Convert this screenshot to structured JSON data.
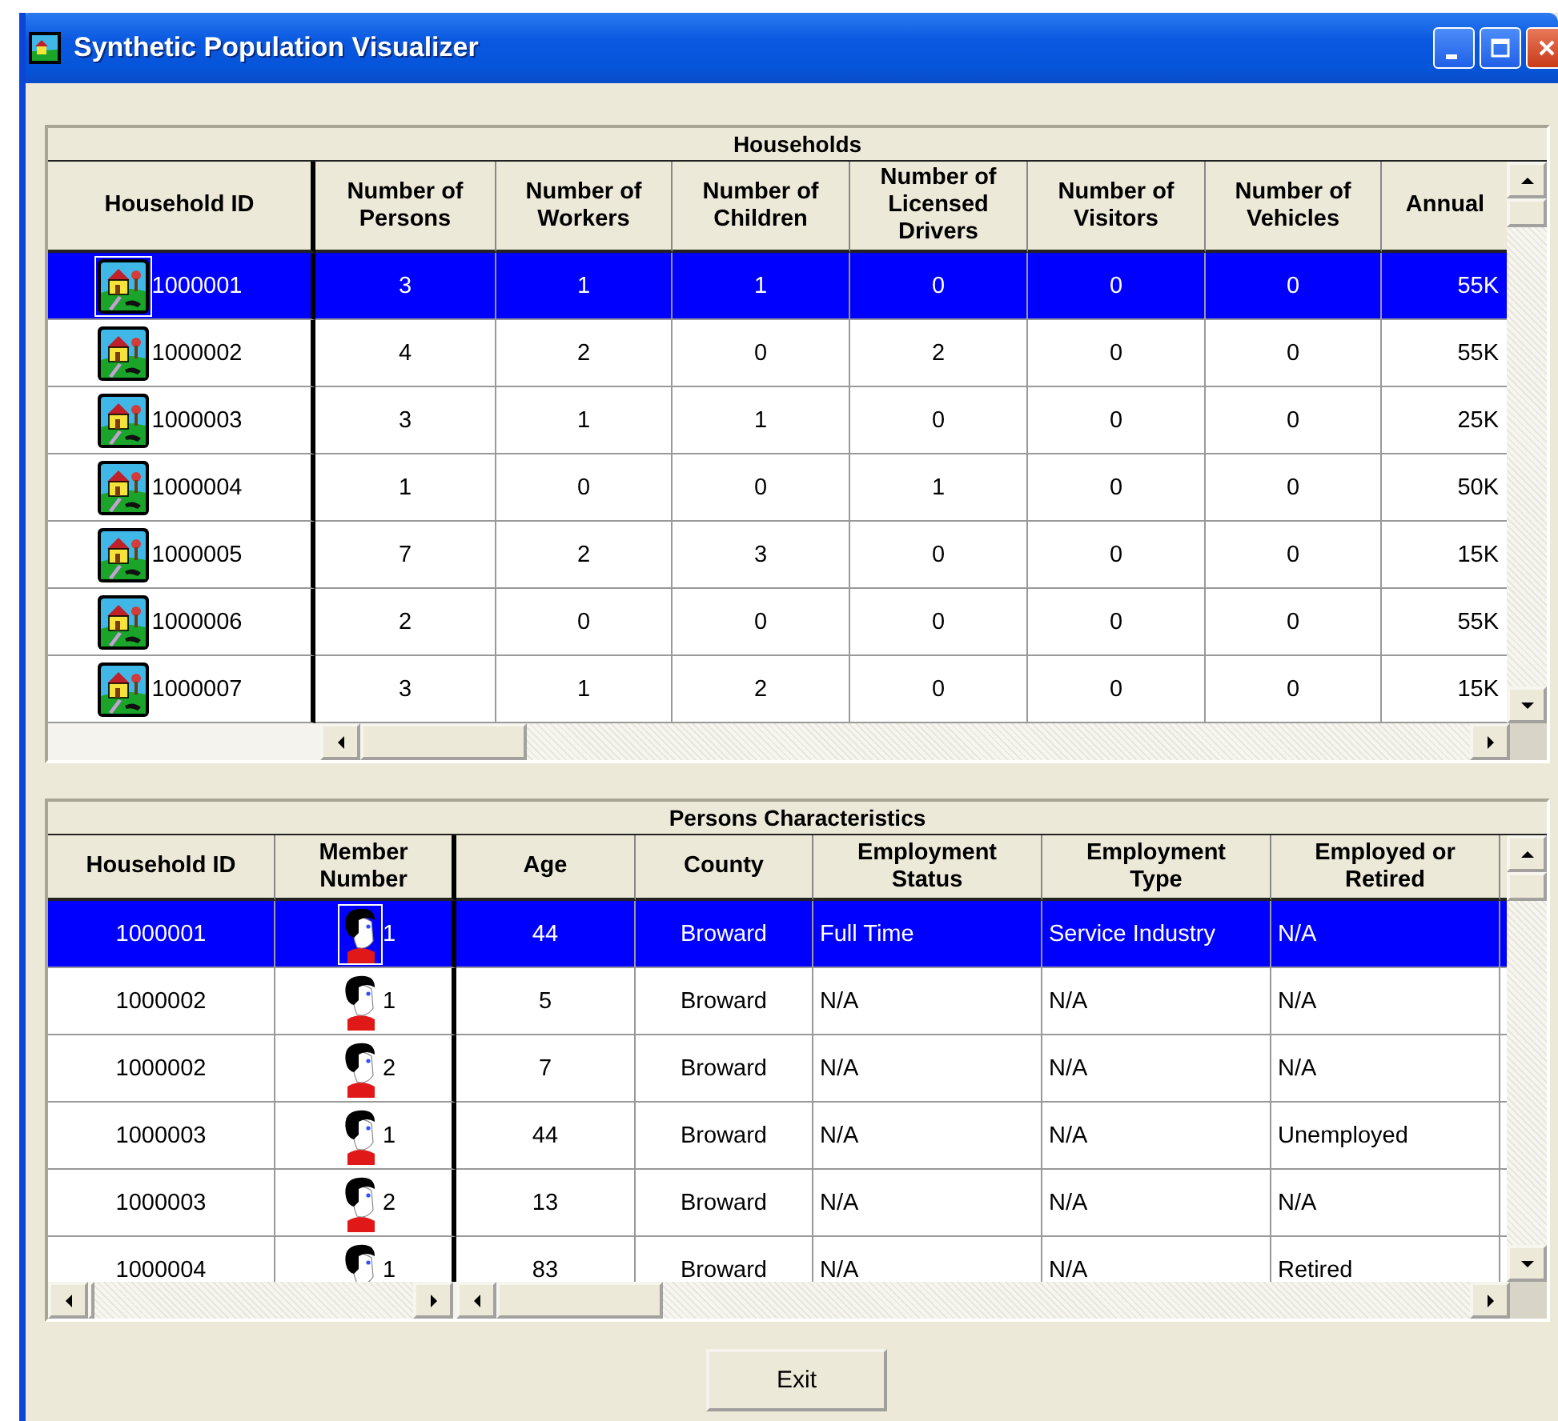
{
  "window": {
    "title": "Synthetic Population Visualizer"
  },
  "households": {
    "title": "Households",
    "columns": [
      "Household ID",
      "Number of Persons",
      "Number of Workers",
      "Number of Children",
      "Number of Licensed Drivers",
      "Number of Visitors",
      "Number of Vehicles",
      "Annual"
    ],
    "rows": [
      {
        "selected": true,
        "cells": [
          "1000001",
          "3",
          "1",
          "1",
          "0",
          "0",
          "0",
          "55K"
        ]
      },
      {
        "selected": false,
        "cells": [
          "1000002",
          "4",
          "2",
          "0",
          "2",
          "0",
          "0",
          "55K"
        ]
      },
      {
        "selected": false,
        "cells": [
          "1000003",
          "3",
          "1",
          "1",
          "0",
          "0",
          "0",
          "25K"
        ]
      },
      {
        "selected": false,
        "cells": [
          "1000004",
          "1",
          "0",
          "0",
          "1",
          "0",
          "0",
          "50K"
        ]
      },
      {
        "selected": false,
        "cells": [
          "1000005",
          "7",
          "2",
          "3",
          "0",
          "0",
          "0",
          "15K"
        ]
      },
      {
        "selected": false,
        "cells": [
          "1000006",
          "2",
          "0",
          "0",
          "0",
          "0",
          "0",
          "55K"
        ]
      },
      {
        "selected": false,
        "cells": [
          "1000007",
          "3",
          "1",
          "2",
          "0",
          "0",
          "0",
          "15K"
        ]
      }
    ]
  },
  "persons": {
    "title": "Persons Characteristics",
    "columns": [
      "Household ID",
      "Member Number",
      "Age",
      "County",
      "Employment Status",
      "Employment Type",
      "Employed or Retired"
    ],
    "rows": [
      {
        "selected": true,
        "cells": [
          "1000001",
          "1",
          "44",
          "Broward",
          "Full Time",
          "Service Industry",
          "N/A"
        ]
      },
      {
        "selected": false,
        "cells": [
          "1000002",
          "1",
          "5",
          "Broward",
          "N/A",
          "N/A",
          "N/A"
        ]
      },
      {
        "selected": false,
        "cells": [
          "1000002",
          "2",
          "7",
          "Broward",
          "N/A",
          "N/A",
          "N/A"
        ]
      },
      {
        "selected": false,
        "cells": [
          "1000003",
          "1",
          "44",
          "Broward",
          "N/A",
          "N/A",
          "Unemployed"
        ]
      },
      {
        "selected": false,
        "cells": [
          "1000003",
          "2",
          "13",
          "Broward",
          "N/A",
          "N/A",
          "N/A"
        ]
      },
      {
        "selected": false,
        "cells": [
          "1000004",
          "1",
          "83",
          "Broward",
          "N/A",
          "N/A",
          "Retired"
        ]
      }
    ]
  },
  "buttons": [
    {
      "label": "Exit"
    }
  ]
}
